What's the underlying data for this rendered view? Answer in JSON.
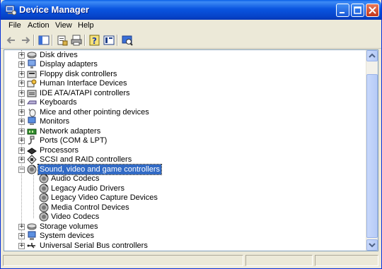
{
  "window": {
    "title": "Device Manager",
    "title_icon": "device-manager-icon"
  },
  "menu": [
    "File",
    "Action",
    "View",
    "Help"
  ],
  "toolbar": [
    "back-icon",
    "forward-icon",
    "show-hide-tree-icon",
    "properties-icon",
    "print-icon",
    "help-icon",
    "console-tree-icon",
    "scan-hardware-icon"
  ],
  "tree": {
    "categories": [
      {
        "label": "Disk drives",
        "icon": "disk-drive-icon",
        "expanded": false
      },
      {
        "label": "Display adapters",
        "icon": "display-adapter-icon",
        "expanded": false
      },
      {
        "label": "Floppy disk controllers",
        "icon": "floppy-controller-icon",
        "expanded": false
      },
      {
        "label": "Human Interface Devices",
        "icon": "hid-icon",
        "expanded": false
      },
      {
        "label": "IDE ATA/ATAPI controllers",
        "icon": "ide-controller-icon",
        "expanded": false
      },
      {
        "label": "Keyboards",
        "icon": "keyboard-icon",
        "expanded": false
      },
      {
        "label": "Mice and other pointing devices",
        "icon": "mouse-icon",
        "expanded": false
      },
      {
        "label": "Monitors",
        "icon": "monitor-icon",
        "expanded": false
      },
      {
        "label": "Network adapters",
        "icon": "network-adapter-icon",
        "expanded": false
      },
      {
        "label": "Ports (COM & LPT)",
        "icon": "port-icon",
        "expanded": false
      },
      {
        "label": "Processors",
        "icon": "processor-icon",
        "expanded": false
      },
      {
        "label": "SCSI and RAID controllers",
        "icon": "scsi-icon",
        "expanded": false
      },
      {
        "label": "Sound, video and game controllers",
        "icon": "sound-icon",
        "expanded": true,
        "selected": true
      },
      {
        "label": "Storage volumes",
        "icon": "storage-volume-icon",
        "expanded": false
      },
      {
        "label": "System devices",
        "icon": "system-device-icon",
        "expanded": false
      },
      {
        "label": "Universal Serial Bus controllers",
        "icon": "usb-icon",
        "expanded": false
      }
    ],
    "children": [
      "Audio Codecs",
      "Legacy Audio Drivers",
      "Legacy Video Capture Devices",
      "Media Control Devices",
      "Video Codecs"
    ]
  },
  "colors": {
    "selection": "#316ac5",
    "titlebar": "#0a55e0"
  }
}
